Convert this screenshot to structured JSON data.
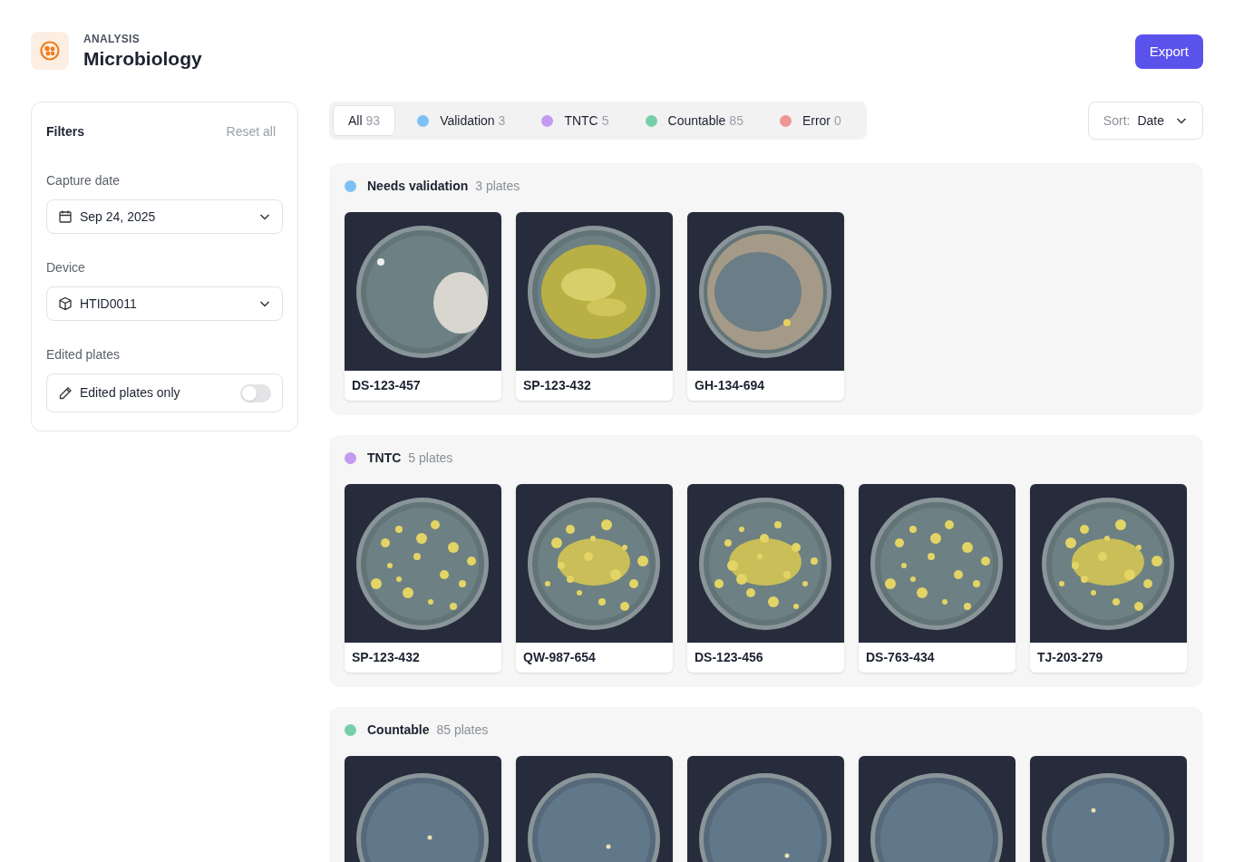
{
  "header": {
    "eyebrow": "ANALYSIS",
    "title": "Microbiology"
  },
  "export_button": "Export",
  "filters": {
    "title": "Filters",
    "reset": "Reset all",
    "fields": [
      {
        "kind": "date",
        "label": "Capture date",
        "value": "Sep 24, 2025"
      },
      {
        "kind": "device",
        "label": "Device",
        "value": "HTID0011"
      },
      {
        "kind": "toggle",
        "label": "Edited plates",
        "value": "Edited plates only",
        "on": false
      }
    ]
  },
  "tabs": [
    {
      "label": "All",
      "count": "93",
      "selected": true
    },
    {
      "label": "Validation",
      "count": "3",
      "color": "#7cc0f5",
      "selected": false
    },
    {
      "label": "TNTC",
      "count": "5",
      "color": "#c39af0",
      "selected": false
    },
    {
      "label": "Countable",
      "count": "85",
      "color": "#79ceaa",
      "selected": false
    },
    {
      "label": "Error",
      "count": "0",
      "color": "#ee9595",
      "selected": false
    }
  ],
  "sort": {
    "label": "Sort:",
    "value": "Date"
  },
  "sections": [
    {
      "title": "Needs validation",
      "count": "3 plates",
      "color": "#7cc0f5",
      "plates": [
        {
          "kind": "card",
          "label": "DS-123-457"
        },
        {
          "kind": "card",
          "label": "SP-123-432"
        },
        {
          "kind": "card",
          "label": "GH-134-694"
        }
      ]
    },
    {
      "title": "TNTC",
      "count": "5 plates",
      "color": "#c39af0",
      "plates": [
        {
          "kind": "card",
          "label": "SP-123-432"
        },
        {
          "kind": "card",
          "label": "QW-987-654"
        },
        {
          "kind": "card",
          "label": "DS-123-456"
        },
        {
          "kind": "card",
          "label": "DS-763-434"
        },
        {
          "kind": "card",
          "label": "TJ-203-279"
        }
      ]
    },
    {
      "title": "Countable",
      "count": "85 plates",
      "color": "#79ceaa"
    }
  ]
}
